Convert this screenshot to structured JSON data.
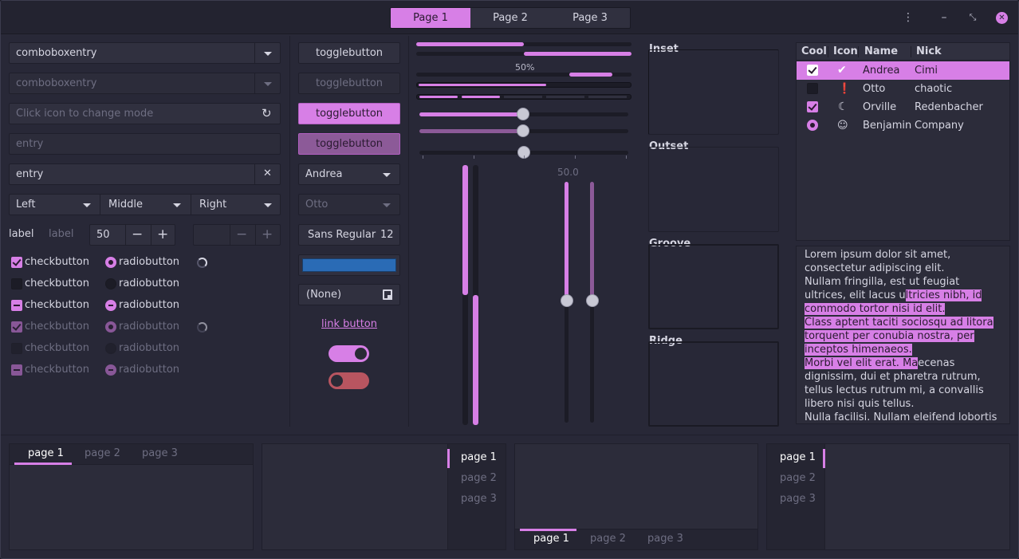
{
  "header": {
    "stack_tabs": [
      "Page 1",
      "Page 2",
      "Page 3"
    ],
    "active_tab": 0,
    "menu_icon": "vertical-dots-icon",
    "minimize_icon": "minimize-icon",
    "maximize_icon": "maximize-icon",
    "close_icon": "close-icon"
  },
  "entries": {
    "combo1": "comboboxentry",
    "combo2": "comboboxentry",
    "mode_placeholder": "Click icon to change mode",
    "entry_placeholder": "entry",
    "entry_value": "entry"
  },
  "linked": [
    "Left",
    "Middle",
    "Right"
  ],
  "spin_row": {
    "label1": "label",
    "label2": "label",
    "value": "50",
    "minus": "−",
    "plus": "+"
  },
  "checks": {
    "check_label": "checkbutton",
    "radio_label": "radiobutton"
  },
  "buttons": {
    "toggle": "togglebutton",
    "combo_active": "Andrea",
    "combo_inactive": "Otto",
    "font": "Sans Regular",
    "font_size": "12",
    "file": "(None)",
    "link": "link button"
  },
  "colors": {
    "accent": "#d77fe6",
    "accent_dim": "#8c5a98",
    "bg": "#282837",
    "color_button": "#2a6bb5",
    "switch_off": "#b85560"
  },
  "progress": {
    "label": "50%",
    "scale_value": "50.0",
    "bar1": 0.5,
    "bar2": 0.5,
    "hscale1": 0.5,
    "hscale2": 0.5,
    "hscale3": 0.5
  },
  "frames": [
    "Inset",
    "Outset",
    "Groove",
    "Ridge"
  ],
  "tree": {
    "columns": [
      "Cool",
      "Icon",
      "Name",
      "Nick"
    ],
    "rows": [
      {
        "cool": "checked",
        "icon": "check-circle-icon",
        "name": "Andrea",
        "nick": "Cimi",
        "selected": true
      },
      {
        "cool": "unchecked",
        "icon": "alert-circle-icon",
        "name": "Otto",
        "nick": "chaotic",
        "selected": false
      },
      {
        "cool": "checked",
        "icon": "moon-icon",
        "name": "Orville",
        "nick": "Redenbacher",
        "selected": false
      },
      {
        "cool": "radio",
        "icon": "robot-icon",
        "name": "Benjamin",
        "nick": "Company",
        "selected": false
      }
    ]
  },
  "textview": {
    "p1": "Lorem ipsum dolor sit amet, consectetur adipiscing elit.",
    "p2a": "Nullam fringilla, est ut feugiat ultrices, elit lacus u",
    "p2b": "ltricies nibh, id commodo tortor nisi id elit.",
    "p3": "Class aptent taciti sociosqu ad litora torquent per conubia nostra, per inceptos himenaeos.",
    "p4a": "Morbi vel elit erat. Ma",
    "p4b": "ecenas dignissim, dui et pharetra rutrum, tellus lectus rutrum mi, a convallis libero nisi quis tellus.",
    "p5": "Nulla facilisi. Nullam eleifend lobortis"
  },
  "notebooks": {
    "tabs": [
      "page 1",
      "page 2",
      "page 3"
    ]
  }
}
